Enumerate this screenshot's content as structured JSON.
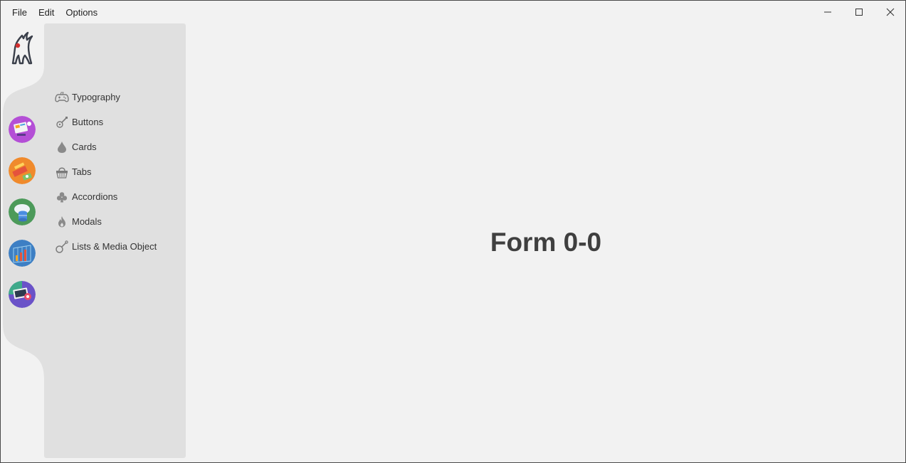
{
  "menubar": {
    "items": [
      "File",
      "Edit",
      "Options"
    ]
  },
  "window_controls": {
    "minimize": "minimize-icon",
    "maximize": "maximize-icon",
    "close": "close-icon"
  },
  "rail": {
    "logo": "duke-mascot-logo",
    "apps": [
      {
        "icon": "design-monitor-icon",
        "color": "#b44fd6"
      },
      {
        "icon": "charts-cash-icon",
        "color": "#f08a2c"
      },
      {
        "icon": "cloud-database-icon",
        "color": "#4c9a5a"
      },
      {
        "icon": "analytics-grid-icon",
        "color": "#3d7fc4"
      },
      {
        "icon": "desktop-settings-icon",
        "color": "#6a52c8"
      }
    ]
  },
  "sidebar": {
    "items": [
      {
        "label": "Typography",
        "icon": "gamepad-icon"
      },
      {
        "label": "Buttons",
        "icon": "guitar-icon"
      },
      {
        "label": "Cards",
        "icon": "drop-icon"
      },
      {
        "label": "Tabs",
        "icon": "basket-icon"
      },
      {
        "label": "Accordions",
        "icon": "club-icon"
      },
      {
        "label": "Modals",
        "icon": "fire-icon"
      },
      {
        "label": "Lists & Media Object",
        "icon": "link-icon"
      }
    ]
  },
  "main": {
    "title": "Form 0-0"
  }
}
